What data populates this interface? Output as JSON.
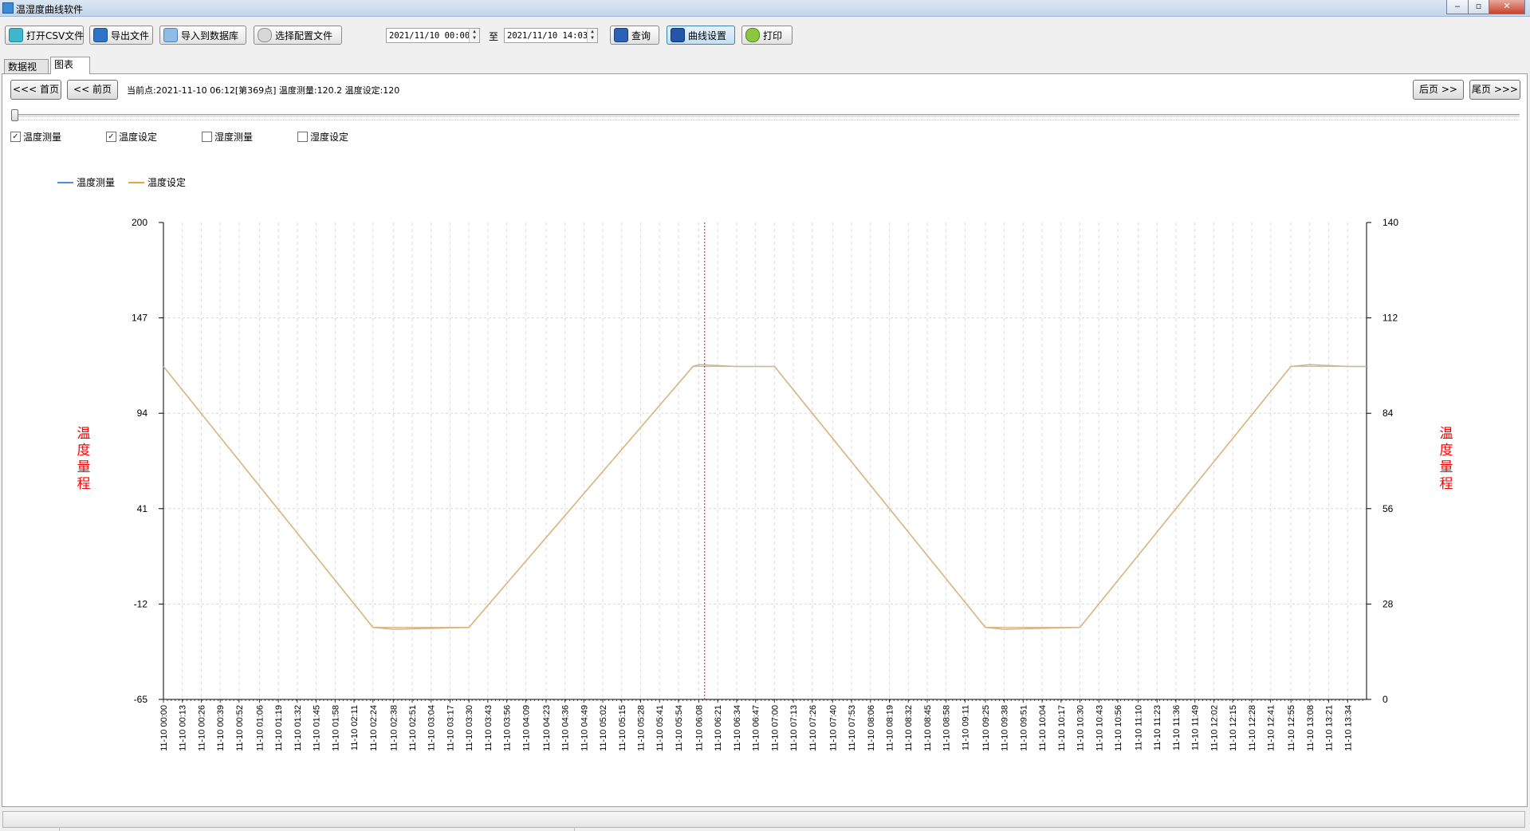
{
  "window": {
    "title": "温湿度曲线软件",
    "buttons": {
      "minimize": "‒",
      "restore": "▫",
      "close": "✕"
    }
  },
  "toolbar": {
    "open_csv": "打开CSV文件",
    "export": "导出文件",
    "import_db": "导入到数据库",
    "select_config": "选择配置文件",
    "date_from": "2021/11/10 00:00",
    "date_sep": "至",
    "date_to": "2021/11/10 14:03",
    "query": "查询",
    "curve_settings": "曲线设置",
    "print": "打印"
  },
  "tabs": {
    "data_view": "数据视图",
    "chart": "图表"
  },
  "nav": {
    "first": "<<< 首页",
    "prev": "<< 前页",
    "next": "后页 >>",
    "last": "尾页 >>>",
    "current_info": "当前点:2021-11-10 06:12[第369点]  温度测量:120.2 温度设定:120"
  },
  "slider": {
    "position": 0
  },
  "checkboxes": [
    {
      "label": "温度测量",
      "checked": true
    },
    {
      "label": "温度设定",
      "checked": true
    },
    {
      "label": "湿度测量",
      "checked": false
    },
    {
      "label": "湿度设定",
      "checked": false
    }
  ],
  "colors": {
    "measure": "#4a90d9",
    "setpoint": "#e8a53d",
    "cursor": "#ff0000",
    "axis_label": "#ff0000"
  },
  "icons": {
    "open_csv": "csv-file-icon",
    "export": "export-icon",
    "import_db": "database-icon",
    "select_config": "config-icon",
    "query": "search-icon",
    "curve_settings": "book-icon",
    "print": "print-icon"
  },
  "chart_data": {
    "type": "line",
    "legend": [
      "温度测量",
      "温度设定"
    ],
    "ylabel_left": "温度量程",
    "ylabel_right": "温度量程",
    "y_left_ticks": [
      "200",
      "147",
      "94",
      "41",
      "-12",
      "-65"
    ],
    "y_left_range": [
      -65,
      200
    ],
    "y_right_ticks": [
      "140",
      "112",
      "84",
      "56",
      "28",
      "0"
    ],
    "y_right_range": [
      0,
      140
    ],
    "x_ticks": [
      "11-10 00:00",
      "11-10 00:13",
      "11-10 00:26",
      "11-10 00:39",
      "11-10 00:52",
      "11-10 01:06",
      "11-10 01:19",
      "11-10 01:32",
      "11-10 01:45",
      "11-10 01:58",
      "11-10 02:11",
      "11-10 02:24",
      "11-10 02:38",
      "11-10 02:51",
      "11-10 03:04",
      "11-10 03:17",
      "11-10 03:30",
      "11-10 03:43",
      "11-10 03:56",
      "11-10 04:09",
      "11-10 04:23",
      "11-10 04:36",
      "11-10 04:49",
      "11-10 05:02",
      "11-10 05:15",
      "11-10 05:28",
      "11-10 05:41",
      "11-10 05:54",
      "11-10 06:08",
      "11-10 06:21",
      "11-10 06:34",
      "11-10 06:47",
      "11-10 07:00",
      "11-10 07:13",
      "11-10 07:26",
      "11-10 07:40",
      "11-10 07:53",
      "11-10 08:06",
      "11-10 08:19",
      "11-10 08:32",
      "11-10 08:45",
      "11-10 08:58",
      "11-10 09:11",
      "11-10 09:25",
      "11-10 09:38",
      "11-10 09:51",
      "11-10 10:04",
      "11-10 10:17",
      "11-10 10:30",
      "11-10 10:43",
      "11-10 10:56",
      "11-10 11:10",
      "11-10 11:23",
      "11-10 11:36",
      "11-10 11:49",
      "11-10 12:02",
      "11-10 12:15",
      "11-10 12:28",
      "11-10 12:41",
      "11-10 12:55",
      "11-10 13:08",
      "11-10 13:21",
      "11-10 13:34"
    ],
    "cursor_time": "11-10 06:12",
    "series": [
      {
        "name": "温度测量",
        "points": [
          [
            "11-10 00:00",
            120
          ],
          [
            "11-10 02:24",
            -25
          ],
          [
            "11-10 02:38",
            -26
          ],
          [
            "11-10 03:30",
            -25
          ],
          [
            "11-10 06:04",
            120
          ],
          [
            "11-10 06:08",
            121
          ],
          [
            "11-10 06:34",
            120
          ],
          [
            "11-10 07:00",
            120
          ],
          [
            "11-10 09:25",
            -25
          ],
          [
            "11-10 09:38",
            -26
          ],
          [
            "11-10 10:30",
            -25
          ],
          [
            "11-10 12:55",
            120
          ],
          [
            "11-10 13:08",
            121
          ],
          [
            "11-10 13:34",
            120
          ],
          [
            "11-10 13:47",
            120
          ]
        ]
      },
      {
        "name": "温度设定",
        "points": [
          [
            "11-10 00:00",
            120
          ],
          [
            "11-10 02:24",
            -25
          ],
          [
            "11-10 03:30",
            -25
          ],
          [
            "11-10 06:04",
            120
          ],
          [
            "11-10 07:00",
            120
          ],
          [
            "11-10 09:25",
            -25
          ],
          [
            "11-10 10:30",
            -25
          ],
          [
            "11-10 12:55",
            120
          ],
          [
            "11-10 13:47",
            120
          ]
        ]
      }
    ]
  }
}
